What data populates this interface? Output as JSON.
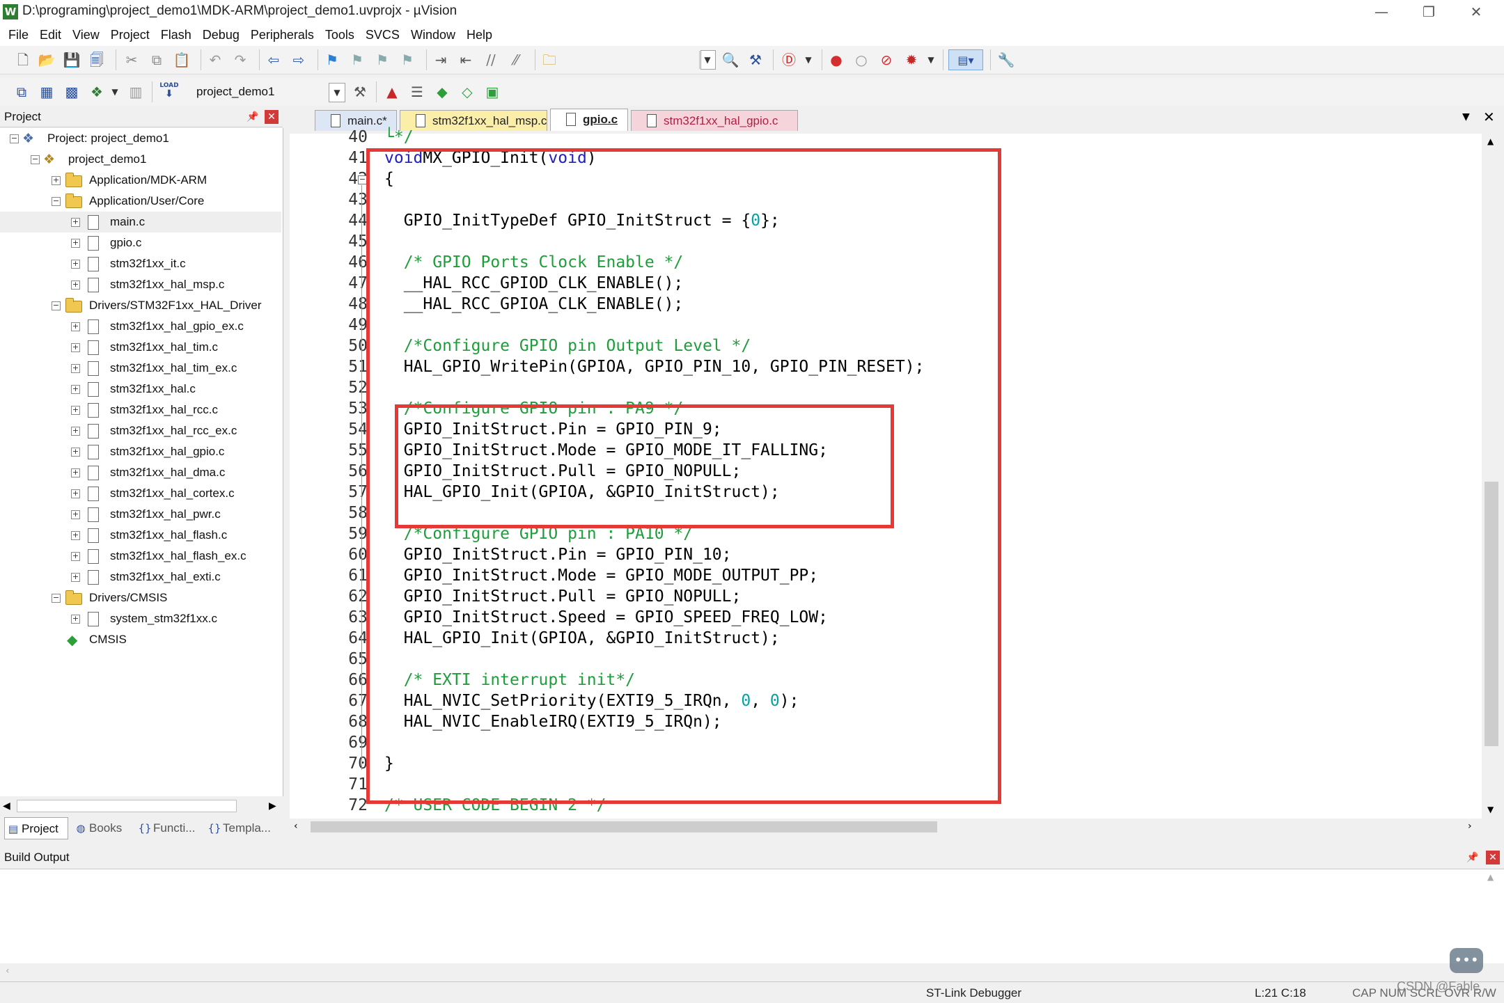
{
  "window": {
    "title": "D:\\programing\\project_demo1\\MDK-ARM\\project_demo1.uvprojx - µVision",
    "app_icon": "W",
    "minimize": "—",
    "restore": "❐",
    "close": "✕"
  },
  "menu": [
    "File",
    "Edit",
    "View",
    "Project",
    "Flash",
    "Debug",
    "Peripherals",
    "Tools",
    "SVCS",
    "Window",
    "Help"
  ],
  "toolbar2": {
    "load_label": "LOAD",
    "target": "project_demo1"
  },
  "project_panel": {
    "title": "Project",
    "tree": [
      {
        "label": "Project: project_demo1",
        "type": "root",
        "level": 0,
        "expander": "⊟"
      },
      {
        "label": "project_demo1",
        "type": "target",
        "level": 1,
        "expander": "⊟"
      },
      {
        "label": "Application/MDK-ARM",
        "type": "folder",
        "level": 2,
        "expander": "⊞"
      },
      {
        "label": "Application/User/Core",
        "type": "folder",
        "level": 2,
        "expander": "⊟"
      },
      {
        "label": "main.c",
        "type": "file",
        "level": 3,
        "expander": "⊞",
        "selected": true
      },
      {
        "label": "gpio.c",
        "type": "file",
        "level": 3,
        "expander": "⊞"
      },
      {
        "label": "stm32f1xx_it.c",
        "type": "file",
        "level": 3,
        "expander": "⊞"
      },
      {
        "label": "stm32f1xx_hal_msp.c",
        "type": "file",
        "level": 3,
        "expander": "⊞"
      },
      {
        "label": "Drivers/STM32F1xx_HAL_Driver",
        "type": "folder",
        "level": 2,
        "expander": "⊟"
      },
      {
        "label": "stm32f1xx_hal_gpio_ex.c",
        "type": "file",
        "level": 3,
        "expander": "⊞"
      },
      {
        "label": "stm32f1xx_hal_tim.c",
        "type": "file",
        "level": 3,
        "expander": "⊞"
      },
      {
        "label": "stm32f1xx_hal_tim_ex.c",
        "type": "file",
        "level": 3,
        "expander": "⊞"
      },
      {
        "label": "stm32f1xx_hal.c",
        "type": "file",
        "level": 3,
        "expander": "⊞"
      },
      {
        "label": "stm32f1xx_hal_rcc.c",
        "type": "file",
        "level": 3,
        "expander": "⊞"
      },
      {
        "label": "stm32f1xx_hal_rcc_ex.c",
        "type": "file",
        "level": 3,
        "expander": "⊞"
      },
      {
        "label": "stm32f1xx_hal_gpio.c",
        "type": "file",
        "level": 3,
        "expander": "⊞"
      },
      {
        "label": "stm32f1xx_hal_dma.c",
        "type": "file",
        "level": 3,
        "expander": "⊞"
      },
      {
        "label": "stm32f1xx_hal_cortex.c",
        "type": "file",
        "level": 3,
        "expander": "⊞"
      },
      {
        "label": "stm32f1xx_hal_pwr.c",
        "type": "file",
        "level": 3,
        "expander": "⊞"
      },
      {
        "label": "stm32f1xx_hal_flash.c",
        "type": "file",
        "level": 3,
        "expander": "⊞"
      },
      {
        "label": "stm32f1xx_hal_flash_ex.c",
        "type": "file",
        "level": 3,
        "expander": "⊞"
      },
      {
        "label": "stm32f1xx_hal_exti.c",
        "type": "file",
        "level": 3,
        "expander": "⊞"
      },
      {
        "label": "Drivers/CMSIS",
        "type": "folder",
        "level": 2,
        "expander": "⊟"
      },
      {
        "label": "system_stm32f1xx.c",
        "type": "file",
        "level": 3,
        "expander": "⊞"
      },
      {
        "label": "CMSIS",
        "type": "component",
        "level": 2,
        "expander": ""
      }
    ],
    "tabs": [
      {
        "label": "Project",
        "icon": "project-icon",
        "glyph": "▤"
      },
      {
        "label": "Books",
        "icon": "books-icon",
        "glyph": "◍"
      },
      {
        "label": "Functi...",
        "icon": "functions-icon",
        "glyph": "{}"
      },
      {
        "label": "Templa...",
        "icon": "templates-icon",
        "glyph": "{}"
      }
    ]
  },
  "editor": {
    "tabs": [
      {
        "label": "main.c*",
        "color": "#dce6f4",
        "active": false
      },
      {
        "label": "stm32f1xx_hal_msp.c",
        "color": "#fbeea8",
        "active": false
      },
      {
        "label": "gpio.c",
        "color": "#ffffff",
        "active": true
      },
      {
        "label": "stm32f1xx_hal_gpio.c",
        "color": "#f6d4dc",
        "active": false
      }
    ],
    "lines": [
      {
        "n": "40",
        "code": "└*/",
        "kind": "comment"
      },
      {
        "n": "41",
        "parts": [
          [
            "kw",
            "void"
          ],
          [
            "",
            "MX_GPIO_Init("
          ],
          [
            "kw",
            "void"
          ],
          [
            "",
            ")"
          ]
        ]
      },
      {
        "n": "42",
        "code": "{",
        "fold": true
      },
      {
        "n": "43",
        "code": ""
      },
      {
        "n": "44",
        "parts": [
          [
            "",
            "  GPIO_InitTypeDef GPIO_InitStruct = {"
          ],
          [
            "num",
            "0"
          ],
          [
            "",
            "};"
          ]
        ]
      },
      {
        "n": "45",
        "code": ""
      },
      {
        "n": "46",
        "parts": [
          [
            "cm",
            "  /* GPIO Ports Clock Enable */"
          ]
        ]
      },
      {
        "n": "47",
        "code": "  __HAL_RCC_GPIOD_CLK_ENABLE();"
      },
      {
        "n": "48",
        "code": "  __HAL_RCC_GPIOA_CLK_ENABLE();"
      },
      {
        "n": "49",
        "code": ""
      },
      {
        "n": "50",
        "parts": [
          [
            "cm",
            "  /*Configure GPIO pin Output Level */"
          ]
        ]
      },
      {
        "n": "51",
        "code": "  HAL_GPIO_WritePin(GPIOA, GPIO_PIN_10, GPIO_PIN_RESET);"
      },
      {
        "n": "52",
        "code": ""
      },
      {
        "n": "53",
        "parts": [
          [
            "cm",
            "  /*Configure GPIO pin : PA9 */"
          ]
        ]
      },
      {
        "n": "54",
        "code": "  GPIO_InitStruct.Pin = GPIO_PIN_9;"
      },
      {
        "n": "55",
        "code": "  GPIO_InitStruct.Mode = GPIO_MODE_IT_FALLING;"
      },
      {
        "n": "56",
        "code": "  GPIO_InitStruct.Pull = GPIO_NOPULL;"
      },
      {
        "n": "57",
        "code": "  HAL_GPIO_Init(GPIOA, &GPIO_InitStruct);"
      },
      {
        "n": "58",
        "code": ""
      },
      {
        "n": "59",
        "parts": [
          [
            "cm",
            "  /*Configure GPIO pin : PA10 */"
          ]
        ]
      },
      {
        "n": "60",
        "code": "  GPIO_InitStruct.Pin = GPIO_PIN_10;"
      },
      {
        "n": "61",
        "code": "  GPIO_InitStruct.Mode = GPIO_MODE_OUTPUT_PP;"
      },
      {
        "n": "62",
        "code": "  GPIO_InitStruct.Pull = GPIO_NOPULL;"
      },
      {
        "n": "63",
        "code": "  GPIO_InitStruct.Speed = GPIO_SPEED_FREQ_LOW;"
      },
      {
        "n": "64",
        "code": "  HAL_GPIO_Init(GPIOA, &GPIO_InitStruct);"
      },
      {
        "n": "65",
        "code": ""
      },
      {
        "n": "66",
        "parts": [
          [
            "cm",
            "  /* EXTI interrupt init*/"
          ]
        ]
      },
      {
        "n": "67",
        "parts": [
          [
            "",
            "  HAL_NVIC_SetPriority(EXTI9_5_IRQn, "
          ],
          [
            "num",
            "0"
          ],
          [
            "",
            ", "
          ],
          [
            "num",
            "0"
          ],
          [
            "",
            ");"
          ]
        ]
      },
      {
        "n": "68",
        "code": "  HAL_NVIC_EnableIRQ(EXTI9_5_IRQn);"
      },
      {
        "n": "69",
        "code": ""
      },
      {
        "n": "70",
        "code": "}"
      },
      {
        "n": "71",
        "code": ""
      },
      {
        "n": "72",
        "parts": [
          [
            "cm",
            "/* USER CODE BEGIN 2 */"
          ]
        ]
      }
    ]
  },
  "build_output": {
    "title": "Build Output"
  },
  "status": {
    "debugger": "ST-Link Debugger",
    "position": "L:21 C:18",
    "indicators": "CAP  NUM  SCRL  OVR  R/W",
    "watermark": "CSDN @Fable"
  },
  "colors": {
    "highlight_box": "#e53935",
    "keyword": "#1f1fbf",
    "comment": "#1e9e3a",
    "number": "#0aa0a0"
  }
}
